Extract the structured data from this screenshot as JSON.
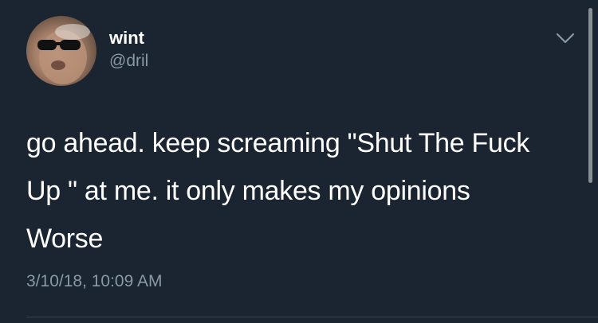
{
  "author": {
    "display_name": "wint",
    "handle": "@dril"
  },
  "tweet": {
    "lines": [
      "go ahead. keep screaming \"Shut The Fuck",
      "Up \" at me. it only makes my opinions",
      "Worse"
    ],
    "timestamp": "3/10/18, 10:09 AM"
  },
  "icons": {
    "menu": "chevron-down-icon",
    "avatar": "profile-photo"
  },
  "colors": {
    "background": "#1b2431",
    "text_primary": "#ffffff",
    "text_secondary": "#8899a6"
  }
}
